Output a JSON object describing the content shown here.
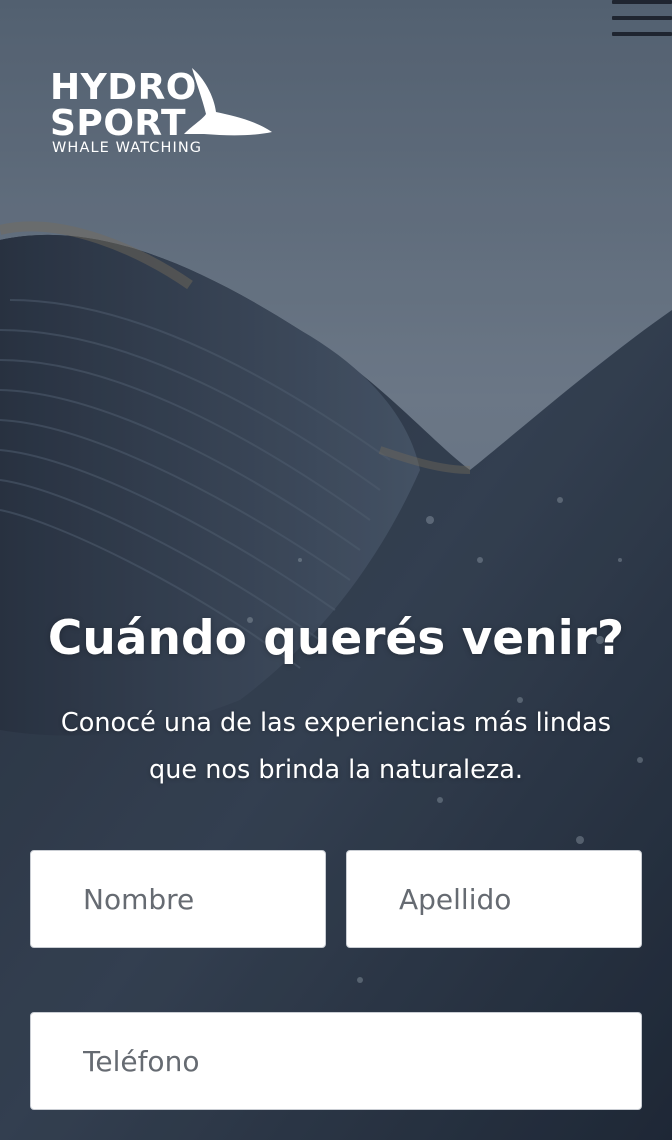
{
  "header": {
    "menu_icon": "hamburger-menu-icon",
    "logo": {
      "line1": "HYDRO",
      "line2": "SPORT",
      "tagline": "WHALE WATCHING",
      "tail_icon": "whale-tail-icon"
    }
  },
  "hero": {
    "headline": "Cuándo querés venir?",
    "subtitle": "Conocé una de las experiencias más lindas que nos brinda la naturaleza."
  },
  "form": {
    "first_name_placeholder": "Nombre",
    "last_name_placeholder": "Apellido",
    "phone_placeholder": "Teléfono"
  },
  "colors": {
    "sky": "#6b7889",
    "whale": "#2d3748",
    "text": "#ffffff"
  }
}
